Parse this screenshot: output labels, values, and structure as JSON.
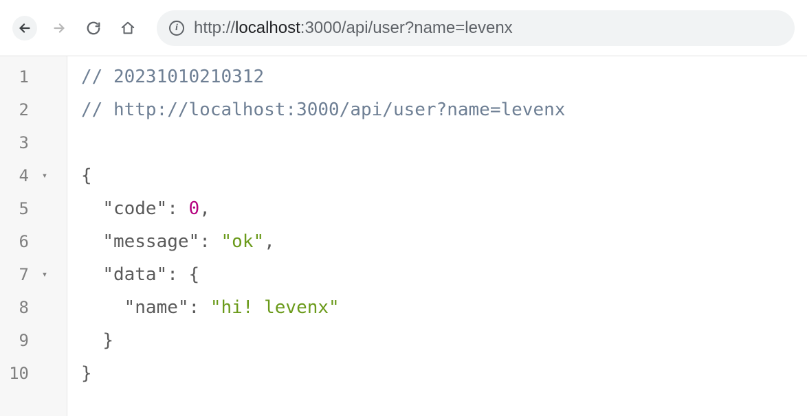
{
  "address": {
    "scheme": "http://",
    "host": "localhost",
    "rest": ":3000/api/user?name=levenx"
  },
  "lines": {
    "n1": "1",
    "n2": "2",
    "n3": "3",
    "n4": "4",
    "n5": "5",
    "n6": "6",
    "n7": "7",
    "n8": "8",
    "n9": "9",
    "n10": "10"
  },
  "fold": {
    "l4": "▾",
    "l7": "▾"
  },
  "code": {
    "comment1": "// 20231010210312",
    "comment2": "// http://localhost:3000/api/user?name=levenx",
    "open_brace": "{",
    "code_key_q": "\"code\"",
    "colon": ":",
    "space": " ",
    "code_val": "0",
    "comma": ",",
    "message_key_q": "\"message\"",
    "message_val": "\"ok\"",
    "data_key_q": "\"data\"",
    "data_open": "{",
    "name_key_q": "\"name\"",
    "name_val": "\"hi! levenx\"",
    "data_close": "}",
    "close_brace": "}"
  }
}
